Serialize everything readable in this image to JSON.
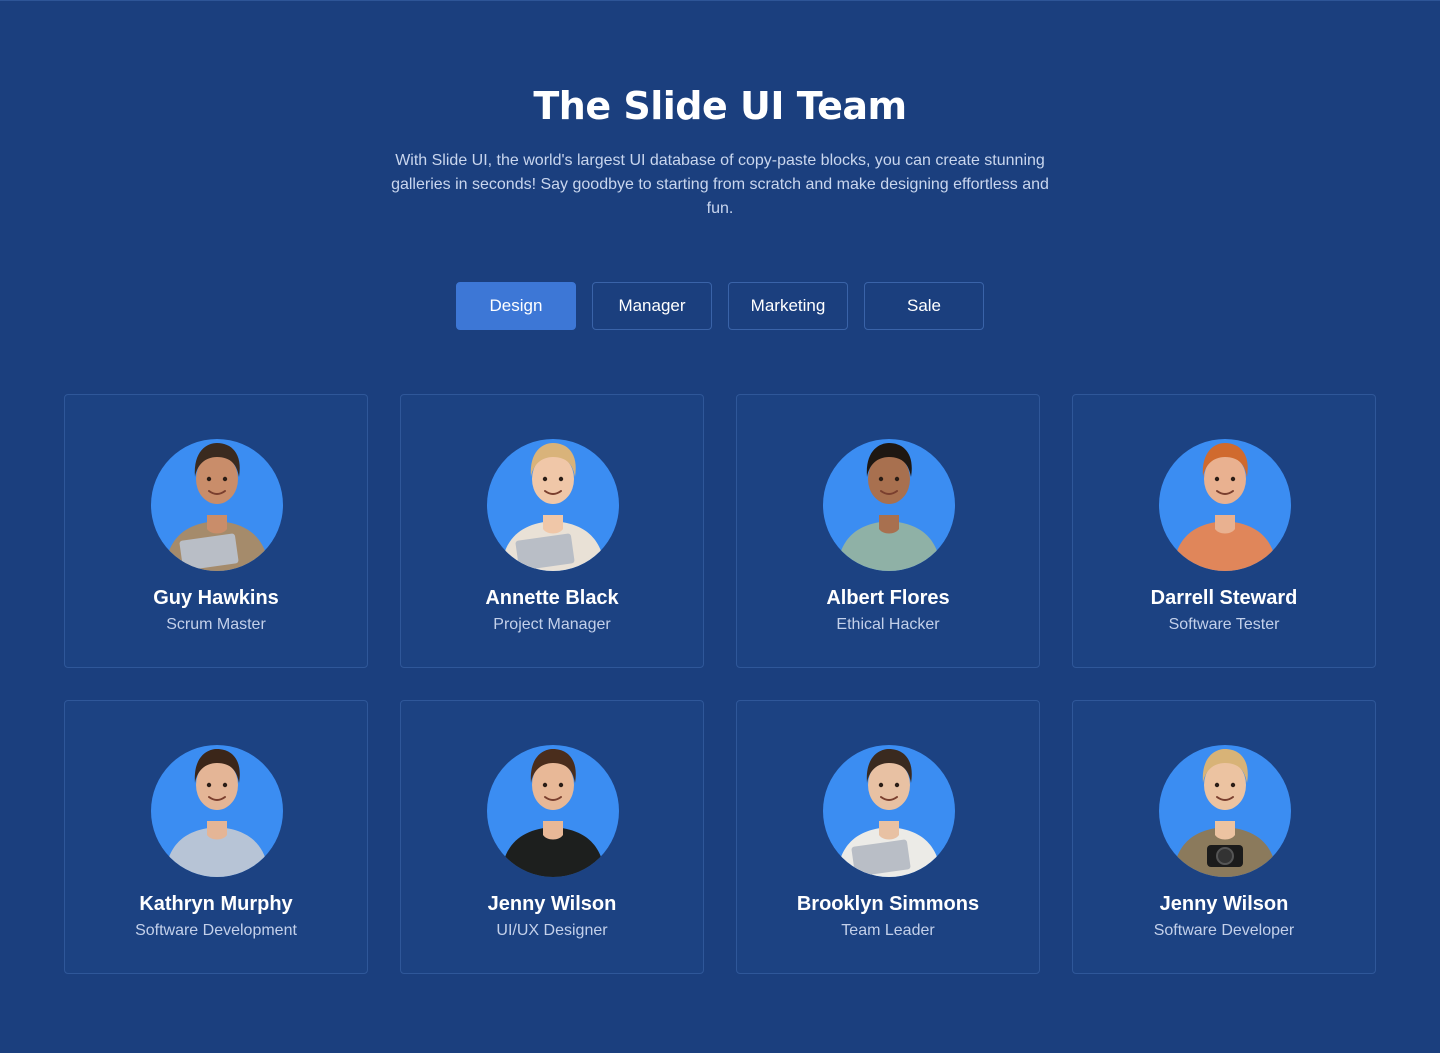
{
  "header": {
    "title": "The Slide UI Team",
    "subtitle": "With Slide UI, the world's largest UI database of copy-paste blocks, you can create stunning galleries in seconds! Say goodbye to starting from scratch and make designing effortless and fun."
  },
  "tabs": [
    {
      "label": "Design",
      "active": true
    },
    {
      "label": "Manager",
      "active": false
    },
    {
      "label": "Marketing",
      "active": false
    },
    {
      "label": "Sale",
      "active": false
    }
  ],
  "members": [
    {
      "name": "Guy Hawkins",
      "role": "Scrum Master",
      "skin": "#c98d6a",
      "hair": "#3a2a1f",
      "shirt": "#a58b6b",
      "prop": "laptop"
    },
    {
      "name": "Annette Black",
      "role": "Project Manager",
      "skin": "#f0c7a8",
      "hair": "#d9b37a",
      "shirt": "#e9e1d6",
      "prop": "laptop"
    },
    {
      "name": "Albert Flores",
      "role": "Ethical Hacker",
      "skin": "#a8704f",
      "hair": "#1e1712",
      "shirt": "#8fb1a6",
      "prop": "none"
    },
    {
      "name": "Darrell Steward",
      "role": "Software Tester",
      "skin": "#e9b190",
      "hair": "#d06a2e",
      "shirt": "#e0865a",
      "prop": "none"
    },
    {
      "name": "Kathryn Murphy",
      "role": "Software Development",
      "skin": "#e4b596",
      "hair": "#3b2619",
      "shirt": "#b7c4d6",
      "prop": "none"
    },
    {
      "name": "Jenny Wilson",
      "role": "UI/UX Designer",
      "skin": "#e8b897",
      "hair": "#4a2d1c",
      "shirt": "#1d1f1e",
      "prop": "none"
    },
    {
      "name": "Brooklyn Simmons",
      "role": "Team Leader",
      "skin": "#e8c1a3",
      "hair": "#3a2a1f",
      "shirt": "#ecebe7",
      "prop": "laptop"
    },
    {
      "name": "Jenny Wilson",
      "role": "Software Developer",
      "skin": "#ecc3a1",
      "hair": "#d8b377",
      "shirt": "#8b7a5c",
      "prop": "camera"
    }
  ]
}
